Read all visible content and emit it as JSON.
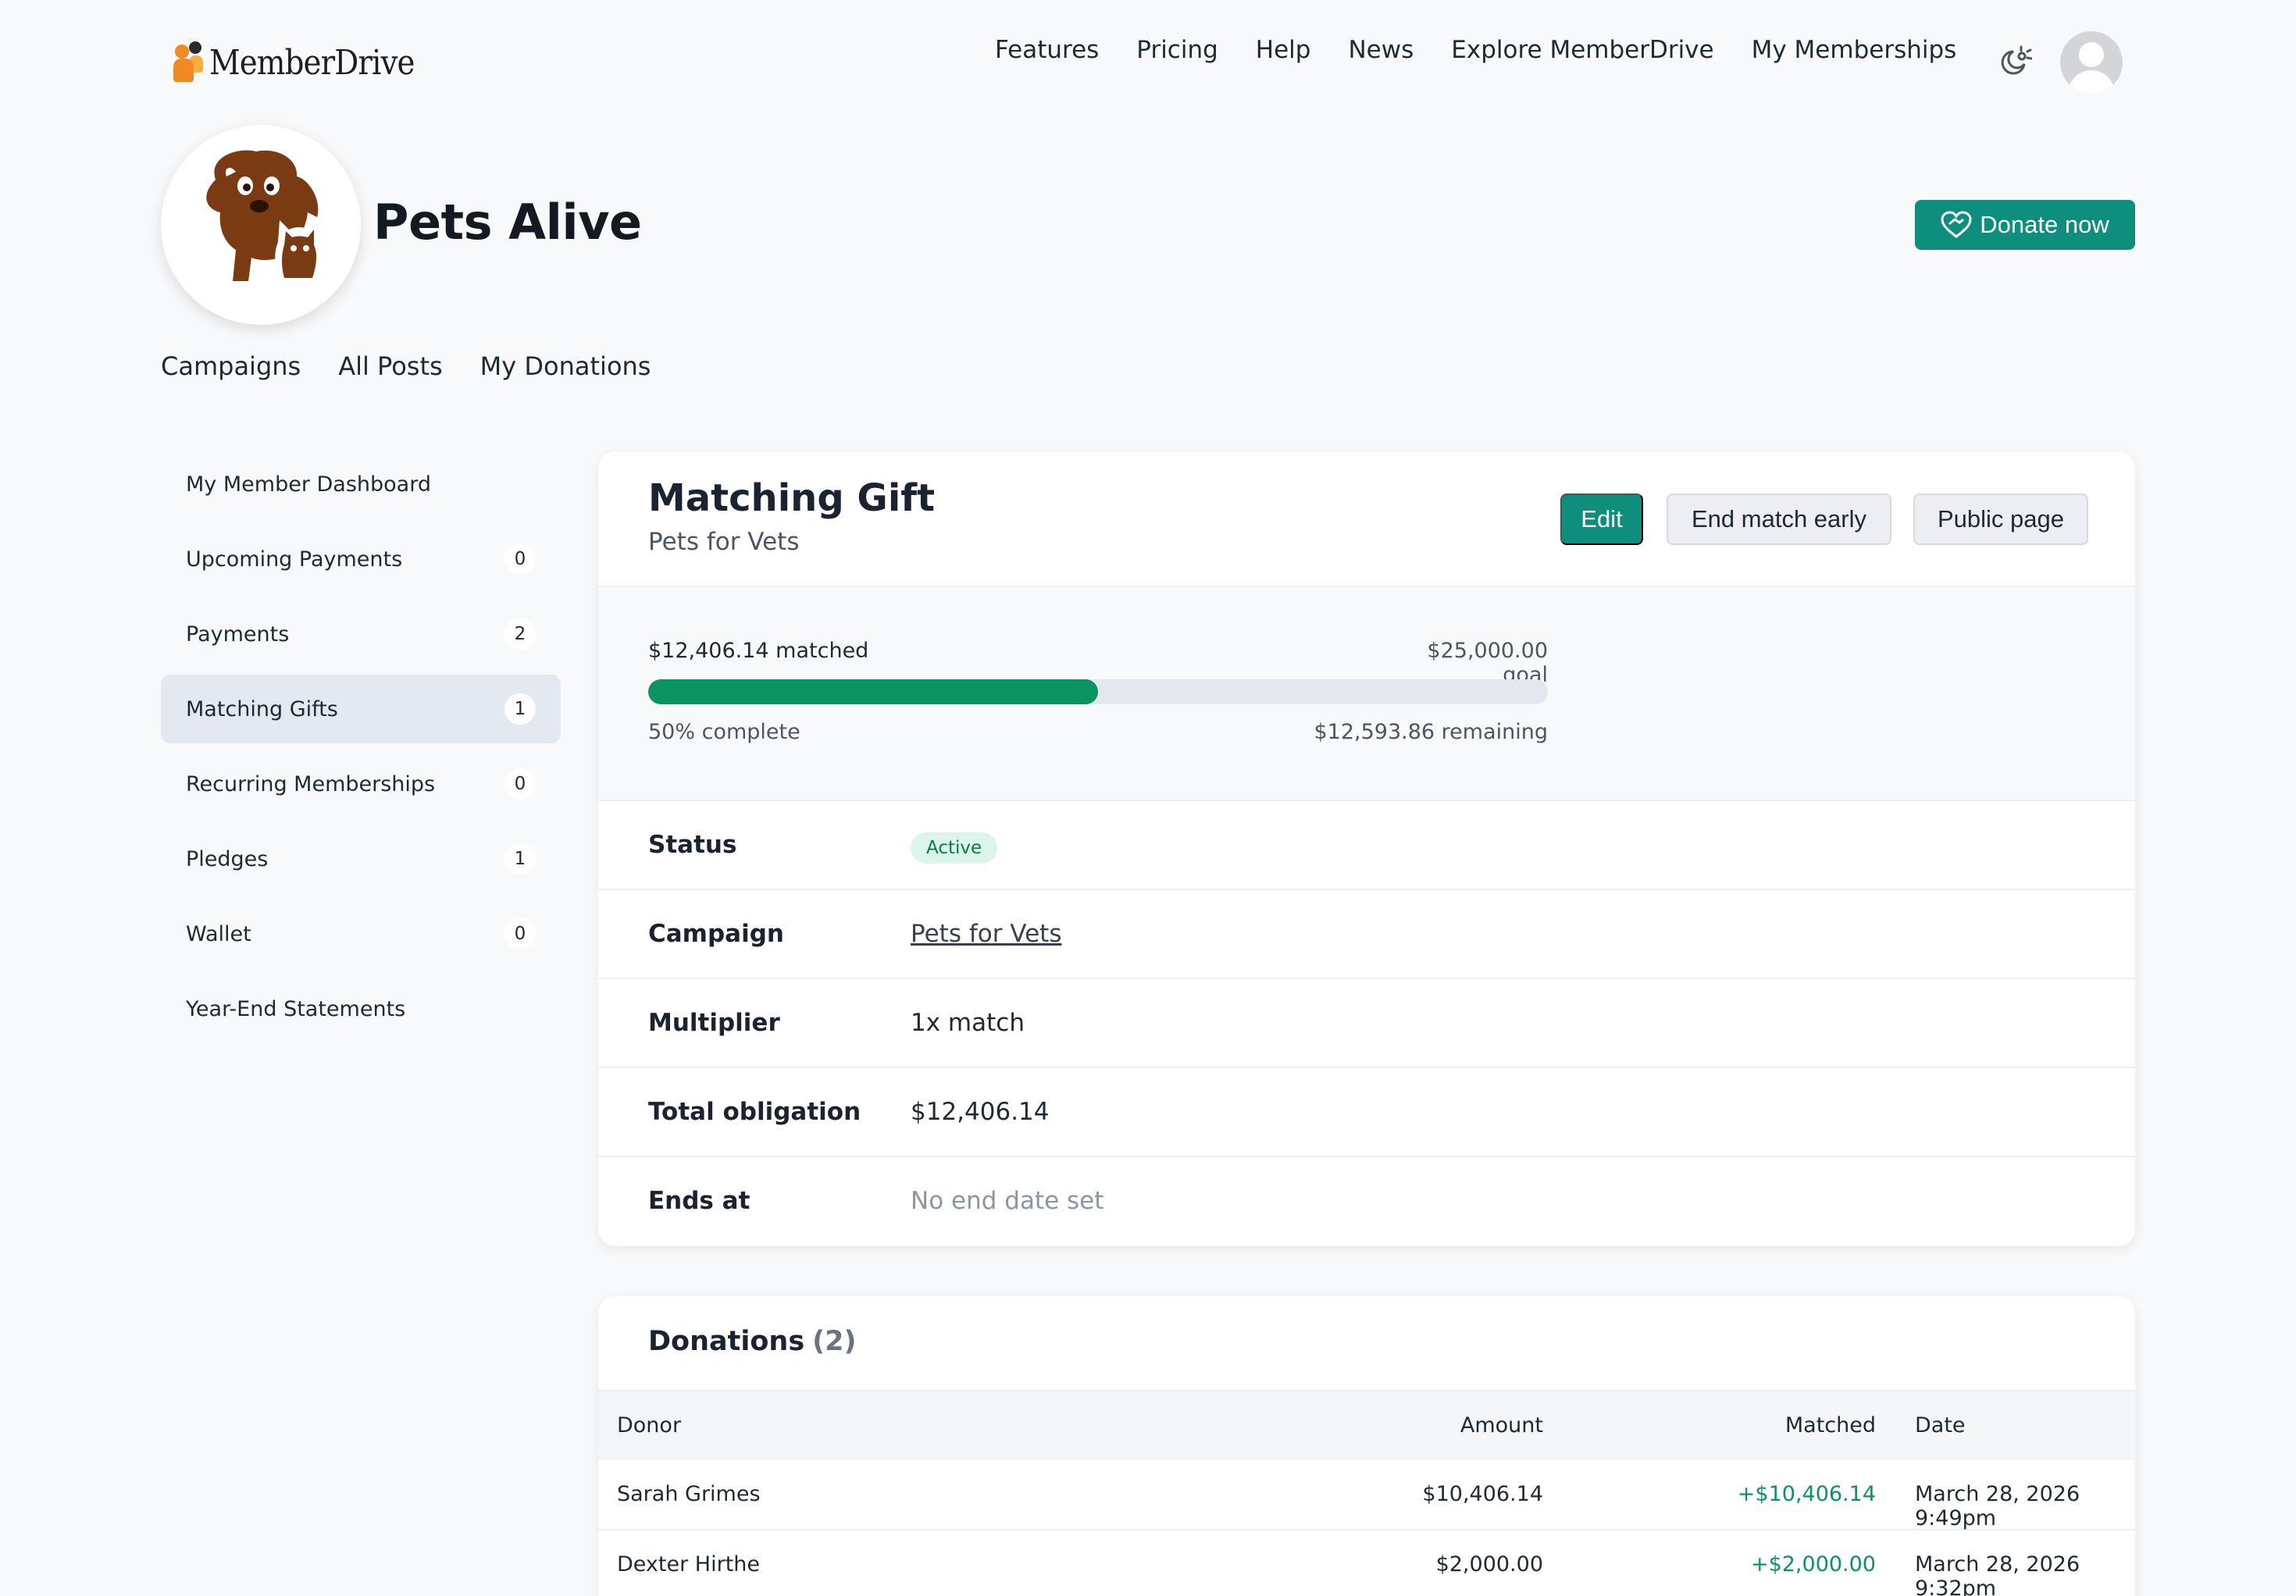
{
  "brand": {
    "name": "MemberDrive"
  },
  "nav": {
    "links": [
      "Features",
      "Pricing",
      "Help",
      "News",
      "Explore MemberDrive",
      "My Memberships"
    ]
  },
  "org": {
    "name": "Pets Alive",
    "donate_label": "Donate now",
    "tabs": [
      "Campaigns",
      "All Posts",
      "My Donations"
    ]
  },
  "sidebar": {
    "items": [
      {
        "label": "My Member Dashboard",
        "count": null,
        "active": false
      },
      {
        "label": "Upcoming Payments",
        "count": "0",
        "active": false
      },
      {
        "label": "Payments",
        "count": "2",
        "active": false
      },
      {
        "label": "Matching Gifts",
        "count": "1",
        "active": true
      },
      {
        "label": "Recurring Memberships",
        "count": "0",
        "active": false
      },
      {
        "label": "Pledges",
        "count": "1",
        "active": false
      },
      {
        "label": "Wallet",
        "count": "0",
        "active": false
      },
      {
        "label": "Year-End Statements",
        "count": null,
        "active": false
      }
    ]
  },
  "match": {
    "title": "Matching Gift",
    "campaign_subtitle": "Pets for Vets",
    "buttons": {
      "edit": "Edit",
      "end_early": "End match early",
      "public_page": "Public page"
    },
    "progress": {
      "matched_text": "$12,406.14 matched",
      "goal_text": "$25,000.00 goal",
      "percent": 50,
      "complete_text": "50% complete",
      "remaining_text": "$12,593.86 remaining"
    },
    "details": {
      "status_label": "Status",
      "status_value": "Active",
      "campaign_label": "Campaign",
      "campaign_value": "Pets for Vets",
      "multiplier_label": "Multiplier",
      "multiplier_value": "1x match",
      "obligation_label": "Total obligation",
      "obligation_value": "$12,406.14",
      "ends_label": "Ends at",
      "ends_value": "No end date set"
    }
  },
  "donations": {
    "title": "Donations",
    "count": "(2)",
    "columns": {
      "donor": "Donor",
      "amount": "Amount",
      "matched": "Matched",
      "date": "Date"
    },
    "rows": [
      {
        "donor": "Sarah Grimes",
        "amount": "$10,406.14",
        "matched": "+$10,406.14",
        "date": "March 28, 2026 9:49pm"
      },
      {
        "donor": "Dexter Hirthe",
        "amount": "$2,000.00",
        "matched": "+$2,000.00",
        "date": "March 28, 2026 9:32pm"
      }
    ]
  },
  "colors": {
    "accent": "#0e8f7e",
    "progress": "#0a9461",
    "active_badge_bg": "#dcf5ea",
    "logo_brown": "#7a3a12"
  }
}
